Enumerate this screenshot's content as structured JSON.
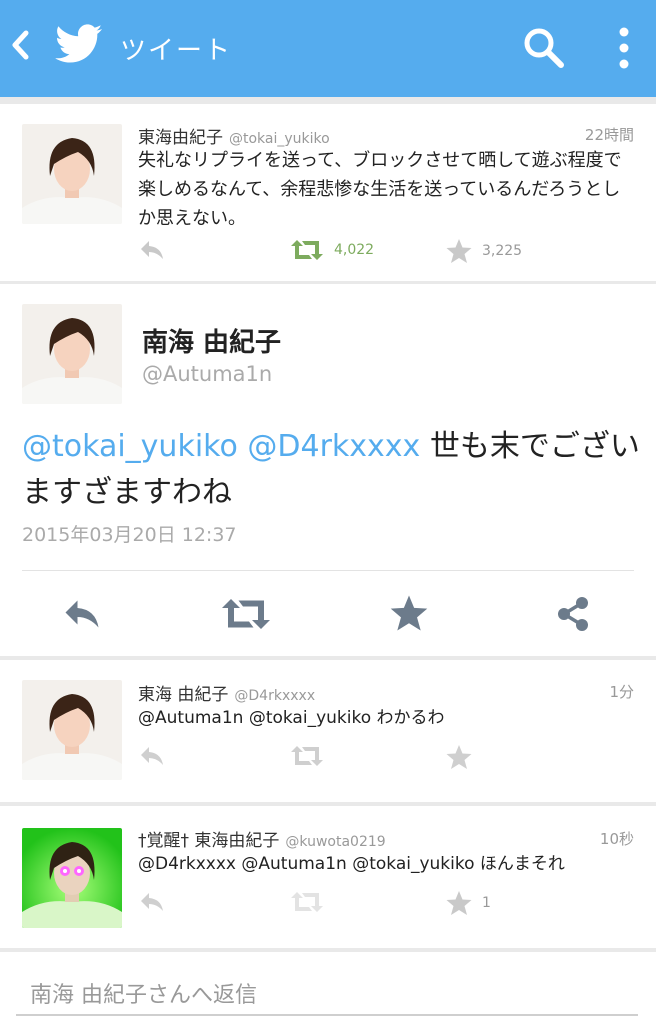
{
  "header": {
    "title": "ツイート",
    "accent": "#55acee",
    "icons": [
      "back-arrow-icon",
      "twitter-bird-icon",
      "search-icon",
      "more-vert-icon"
    ]
  },
  "tweets": [
    {
      "name": "東海由紀子",
      "handle": "@tokai_yukiko",
      "time": "22時間",
      "text": "失礼なリプライを送って、ブロックさせて晒して遊ぶ程度で楽しめるなんて、余程悲惨な生活を送っているんだろうとしか思えない。",
      "retweets": "4,022",
      "favorites": "3,225"
    },
    {
      "name": "東海 由紀子",
      "handle": "@D4rkxxxx",
      "time": "1分",
      "text_mentions": "@Autuma1n @tokai_yukiko",
      "text_rest": " わかるわ"
    },
    {
      "name": "†覚醒† 東海由紀子",
      "handle": "@kuwota0219",
      "time": "10秒",
      "text_mentions": "@D4rkxxxx @Autuma1n @tokai_yukiko",
      "text_rest": " ほんまそれ",
      "favorites": "1"
    }
  ],
  "detail": {
    "name": "南海 由紀子",
    "handle": "@Autuma1n",
    "mention1": "@tokai_yukiko",
    "mention2": "@D4rkxxxx",
    "text": " 世も末でございますざますわね",
    "date": "2015年03月20日 12:37"
  },
  "reply": {
    "placeholder": "南海 由紀子さんへ返信"
  }
}
